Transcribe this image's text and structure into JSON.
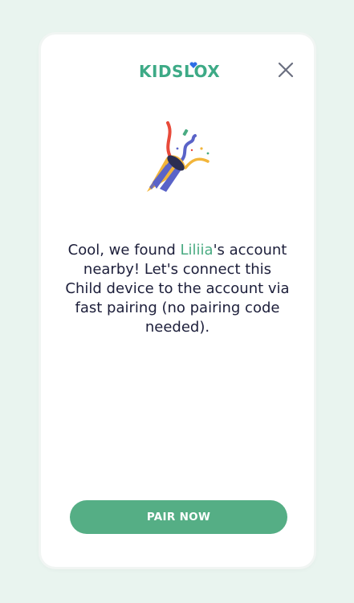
{
  "brand": {
    "logo_text": "KIDSLOX",
    "logo_color": "#3daa86",
    "heart_color": "#2d6ee6"
  },
  "header": {
    "close_icon": "close-icon"
  },
  "illustration": {
    "icon": "party-popper-icon"
  },
  "message": {
    "part1": "Cool, we found ",
    "child_name": "Liliia",
    "part2": "'s account nearby! Let's connect this Child device to the account via fast pairing (no pairing code needed)."
  },
  "actions": {
    "pair_label": "PAIR NOW"
  },
  "colors": {
    "background": "#e9f4ef",
    "card": "#ffffff",
    "accent": "#55ae85",
    "text": "#1c1e3a",
    "highlight": "#4aab82"
  }
}
